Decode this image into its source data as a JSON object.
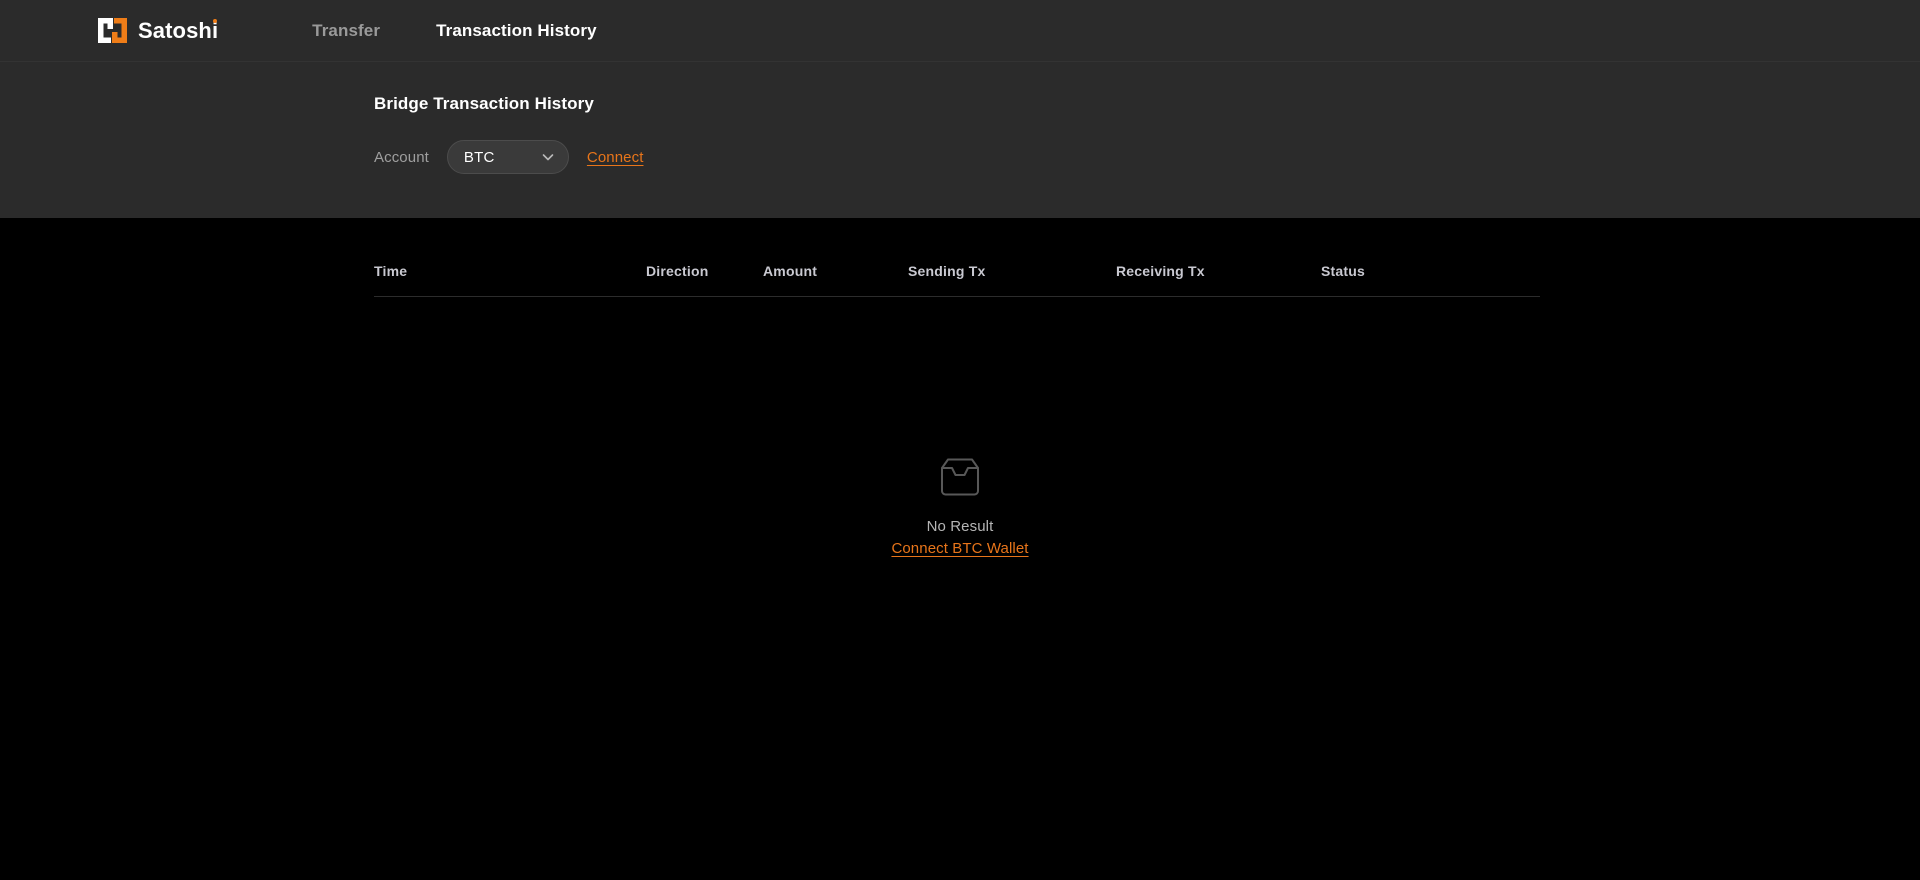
{
  "brand": {
    "name": "Satoshi",
    "logo_icon": "satoshi-logo-icon",
    "colors": {
      "primary": "#ef7d18",
      "mark_white": "#ffffff"
    }
  },
  "nav": {
    "items": [
      {
        "label": "Transfer",
        "active": false
      },
      {
        "label": "Transaction History",
        "active": true
      }
    ]
  },
  "subheader": {
    "title": "Bridge Transaction History",
    "account_label": "Account",
    "account_value": "BTC",
    "account_options": [
      "BTC"
    ],
    "dropdown_icon": "chevron-down-icon",
    "connect_label": "Connect"
  },
  "table": {
    "columns": [
      "Time",
      "Direction",
      "Amount",
      "Sending Tx",
      "Receiving Tx",
      "Status"
    ],
    "rows": []
  },
  "empty_state": {
    "icon": "inbox-tray-icon",
    "message": "No Result",
    "action_label": "Connect BTC Wallet"
  },
  "theme": {
    "nav_bg": "#2b2b2b",
    "body_bg": "#000000",
    "accent": "#e8751a",
    "muted_text": "#9a9a9a"
  }
}
